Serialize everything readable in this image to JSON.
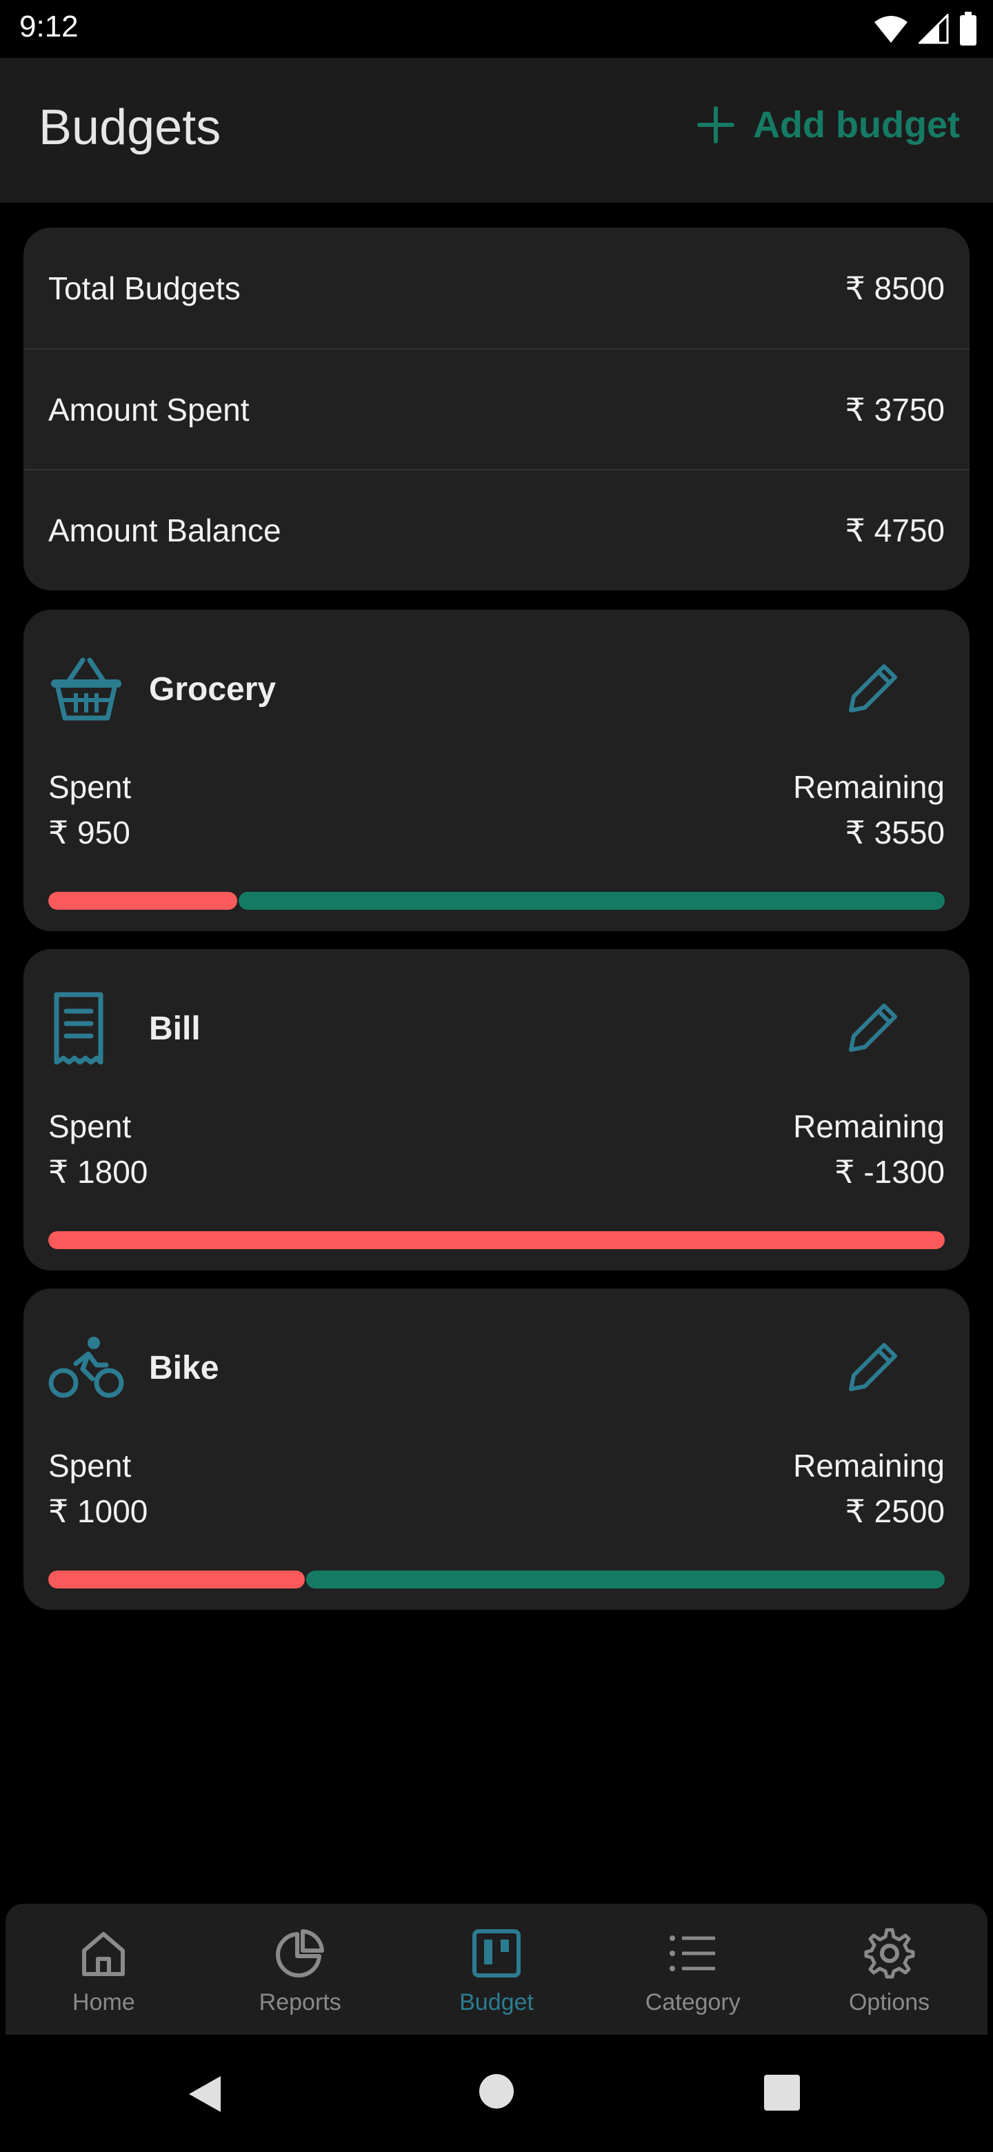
{
  "status": {
    "time": "9:12"
  },
  "header": {
    "title": "Budgets",
    "add_label": "Add budget"
  },
  "summary": [
    {
      "label": "Total Budgets",
      "value": "₹ 8500"
    },
    {
      "label": "Amount Spent",
      "value": "₹ 3750"
    },
    {
      "label": "Amount Balance",
      "value": "₹ 4750"
    }
  ],
  "budgets": [
    {
      "name": "Grocery",
      "icon": "basket-icon",
      "spent_label": "Spent",
      "spent": "₹ 950",
      "remaining_label": "Remaining",
      "remaining": "₹ 3550",
      "spent_fraction": 0.211
    },
    {
      "name": "Bill",
      "icon": "receipt-icon",
      "spent_label": "Spent",
      "spent": "₹ 1800",
      "remaining_label": "Remaining",
      "remaining": "₹ -1300",
      "spent_fraction": 1.0
    },
    {
      "name": "Bike",
      "icon": "bicycle-icon",
      "spent_label": "Spent",
      "spent": "₹ 1000",
      "remaining_label": "Remaining",
      "remaining": "₹ 2500",
      "spent_fraction": 0.286
    }
  ],
  "nav": [
    {
      "label": "Home",
      "icon": "home-icon"
    },
    {
      "label": "Reports",
      "icon": "pie-chart-icon"
    },
    {
      "label": "Budget",
      "icon": "budget-board-icon",
      "active": true
    },
    {
      "label": "Category",
      "icon": "list-icon"
    },
    {
      "label": "Options",
      "icon": "gear-icon"
    }
  ],
  "colors": {
    "accent": "#167b64",
    "spent": "#fa5a5a",
    "remaining": "#157a63",
    "icon": "#2c7c91"
  }
}
